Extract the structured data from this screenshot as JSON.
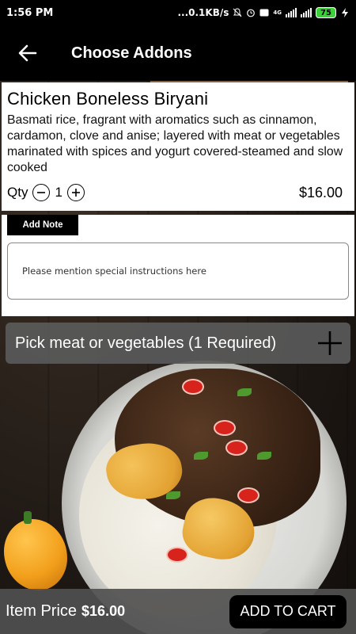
{
  "status_bar": {
    "time": "1:56 PM",
    "speed": "...0.1KB/s",
    "network_label": "4G",
    "battery": "75"
  },
  "app_bar": {
    "title": "Choose Addons",
    "back_icon": "arrow-left-icon"
  },
  "item": {
    "name": "Chicken Boneless Biryani",
    "description": "Basmati rice, fragrant with aromatics such as cinnamon, cardamon, clove and anise; layered with meat or vegetables marinated with spices and yogurt covered-steamed and slow cooked",
    "qty_label": "Qty",
    "quantity": "1",
    "price": "$16.00"
  },
  "note": {
    "button_label": "Add Note",
    "placeholder": "Please mention special instructions here"
  },
  "addon_group": {
    "label": "Pick meat or vegetables (1 Required)",
    "icon": "plus-icon"
  },
  "footer": {
    "item_price_label": "Item Price",
    "item_price_value": "$16.00",
    "add_to_cart_label": "ADD TO CART"
  },
  "colors": {
    "bar_background": "#000000",
    "card_background": "#ffffff",
    "picker_background": "#5a5a5a",
    "battery_green": "#3bd13b"
  }
}
